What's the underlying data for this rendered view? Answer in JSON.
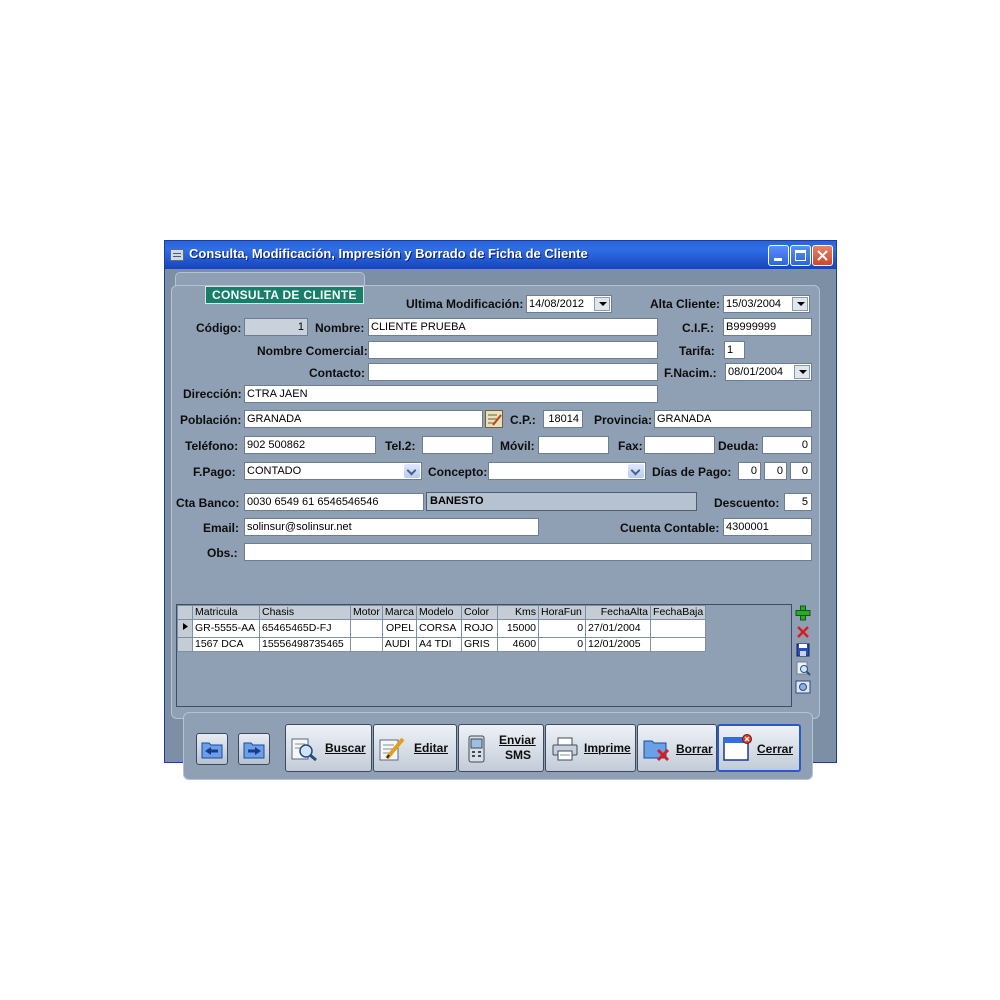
{
  "window": {
    "title": "Consulta, Modificación, Impresión y Borrado de Ficha de Cliente"
  },
  "header": {
    "badge": "CONSULTA DE CLIENTE",
    "ultima_modificacion_label": "Ultima Modificación:",
    "ultima_modificacion_value": "14/08/2012",
    "alta_cliente_label": "Alta Cliente:",
    "alta_cliente_value": "15/03/2004"
  },
  "form": {
    "codigo_label": "Código:",
    "codigo_value": "1",
    "nombre_label": "Nombre:",
    "nombre_value": "CLIENTE PRUEBA",
    "cif_label": "C.I.F.:",
    "cif_value": "B9999999",
    "nombre_comercial_label": "Nombre Comercial:",
    "nombre_comercial_value": "",
    "tarifa_label": "Tarifa:",
    "tarifa_value": "1",
    "contacto_label": "Contacto:",
    "contacto_value": "",
    "fnacim_label": "F.Nacim.:",
    "fnacim_value": "08/01/2004",
    "direccion_label": "Dirección:",
    "direccion_value": "CTRA JAEN",
    "poblacion_label": "Población:",
    "poblacion_value": "GRANADA",
    "cp_label": "C.P.:",
    "cp_value": "18014",
    "provincia_label": "Provincia:",
    "provincia_value": "GRANADA",
    "telefono_label": "Teléfono:",
    "telefono_value": "902 500862",
    "tel2_label": "Tel.2:",
    "tel2_value": "",
    "movil_label": "Móvil:",
    "movil_value": "",
    "fax_label": "Fax:",
    "fax_value": "",
    "deuda_label": "Deuda:",
    "deuda_value": "0",
    "fpago_label": "F.Pago:",
    "fpago_value": "CONTADO",
    "concepto_label": "Concepto:",
    "concepto_value": "",
    "dias_pago_label": "Días de Pago:",
    "dias_pago_1": "0",
    "dias_pago_2": "0",
    "dias_pago_3": "0",
    "cta_banco_label": "Cta Banco:",
    "cta_banco_value": "0030 6549 61 6546546546",
    "banco_name": "BANESTO",
    "descuento_label": "Descuento:",
    "descuento_value": "5",
    "email_label": "Email:",
    "email_value": "solinsur@solinsur.net",
    "cuenta_contable_label": "Cuenta Contable:",
    "cuenta_contable_value": "4300001",
    "obs_label": "Obs.:",
    "obs_value": ""
  },
  "grid": {
    "columns": [
      "Matricula",
      "Chasis",
      "Motor",
      "Marca",
      "Modelo",
      "Color",
      "Kms",
      "HoraFun",
      "FechaAlta",
      "FechaBaja"
    ],
    "rows": [
      [
        "GR-5555-AA",
        "65465465D-FJ",
        "",
        "OPEL",
        "CORSA",
        "ROJO",
        "15000",
        "0",
        "27/01/2004",
        ""
      ],
      [
        "1567 DCA",
        "15556498735465",
        "",
        "AUDI",
        "A4 TDI",
        "GRIS",
        "4600",
        "0",
        "12/01/2005",
        ""
      ]
    ]
  },
  "toolbar": {
    "buscar": "Buscar",
    "editar": "Editar",
    "enviar_line1": "Enviar",
    "enviar_line2": "SMS",
    "imprime": "Imprime",
    "borrar": "Borrar",
    "cerrar": "Cerrar"
  },
  "colors": {
    "titlebar": "#2f6ee6",
    "window_bg": "#7d8fa4",
    "panel_bg": "#8fa0b5",
    "badge_bg": "#1a7d6a"
  }
}
